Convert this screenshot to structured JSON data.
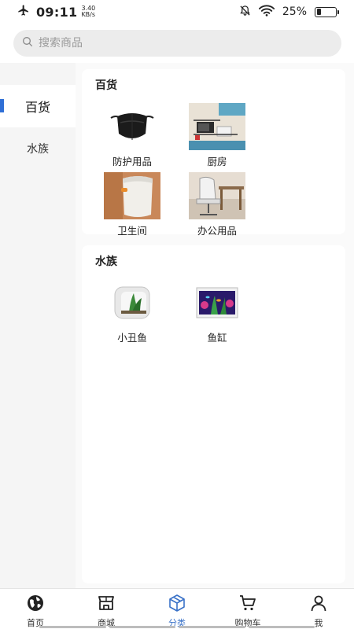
{
  "status_bar": {
    "time": "09:11",
    "speed_value": "3.40",
    "speed_unit": "KB/s",
    "battery": "25%",
    "battery_level": 0.25
  },
  "search": {
    "placeholder": "搜索商品"
  },
  "sidebar": {
    "items": [
      {
        "label": "百货",
        "active": true
      },
      {
        "label": "水族",
        "active": false
      }
    ]
  },
  "sections": [
    {
      "title": "百货",
      "items": [
        {
          "label": "防护用品",
          "icon": "face-mask-image"
        },
        {
          "label": "厨房",
          "icon": "kitchen-shelf-image"
        },
        {
          "label": "卫生间",
          "icon": "trash-bin-image"
        },
        {
          "label": "办公用品",
          "icon": "office-chair-image"
        }
      ]
    },
    {
      "title": "水族",
      "items": [
        {
          "label": "小丑鱼",
          "icon": "small-fish-tank-image"
        },
        {
          "label": "鱼缸",
          "icon": "aquarium-image"
        }
      ]
    }
  ],
  "tab_bar": {
    "tabs": [
      {
        "label": "首页",
        "icon": "globe-icon",
        "active": false
      },
      {
        "label": "商城",
        "icon": "store-icon",
        "active": false
      },
      {
        "label": "分类",
        "icon": "cube-icon",
        "active": true
      },
      {
        "label": "购物车",
        "icon": "cart-icon",
        "active": false
      },
      {
        "label": "我",
        "icon": "user-icon",
        "active": false
      }
    ]
  },
  "colors": {
    "accent": "#3a72c8",
    "sidebar_marker": "#2f6fd6"
  }
}
